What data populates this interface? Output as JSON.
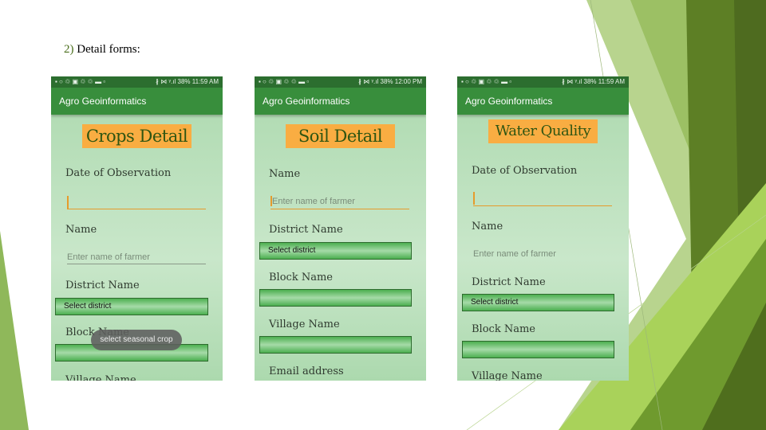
{
  "slide": {
    "number": "2)",
    "title": "Detail forms:"
  },
  "colors": {
    "status_bar": "#2c6e2f",
    "app_bar": "#388e3c",
    "title_box": "#f9ad42",
    "select": "#4caf50",
    "accent_underline": "#e69b2c"
  },
  "status_icons": "▪ ○ ♲ ▣ ♲ ♲ ▬ ▫",
  "status_right_icons": "∦ ⋈ ᵞ.ıl",
  "phones": [
    {
      "time": "11:59 AM",
      "battery": "38%",
      "app_title": "Agro Geoinformatics",
      "form_title": "Crops Detail",
      "fields": {
        "date": "Date of Observation",
        "name": "Name",
        "name_placeholder": "Enter name of farmer",
        "district": "District Name",
        "district_select": "Select district",
        "block": "Block Name",
        "village": "Village Name"
      },
      "toast": "select seasonal crop"
    },
    {
      "time": "12:00 PM",
      "battery": "38%",
      "app_title": "Agro Geoinformatics",
      "form_title": "Soil Detail",
      "fields": {
        "name": "Name",
        "name_placeholder": "Enter name of farmer",
        "district": "District Name",
        "district_select": "Select district",
        "block": "Block Name",
        "village": "Village Name",
        "email": "Email address"
      }
    },
    {
      "time": "11:59 AM",
      "battery": "38%",
      "app_title": "Agro Geoinformatics",
      "form_title": "Water Quality",
      "fields": {
        "date": "Date of Observation",
        "name": "Name",
        "name_placeholder": "Enter name of farmer",
        "district": "District Name",
        "district_select": "Select district",
        "block": "Block Name",
        "village": "Village Name"
      }
    }
  ]
}
